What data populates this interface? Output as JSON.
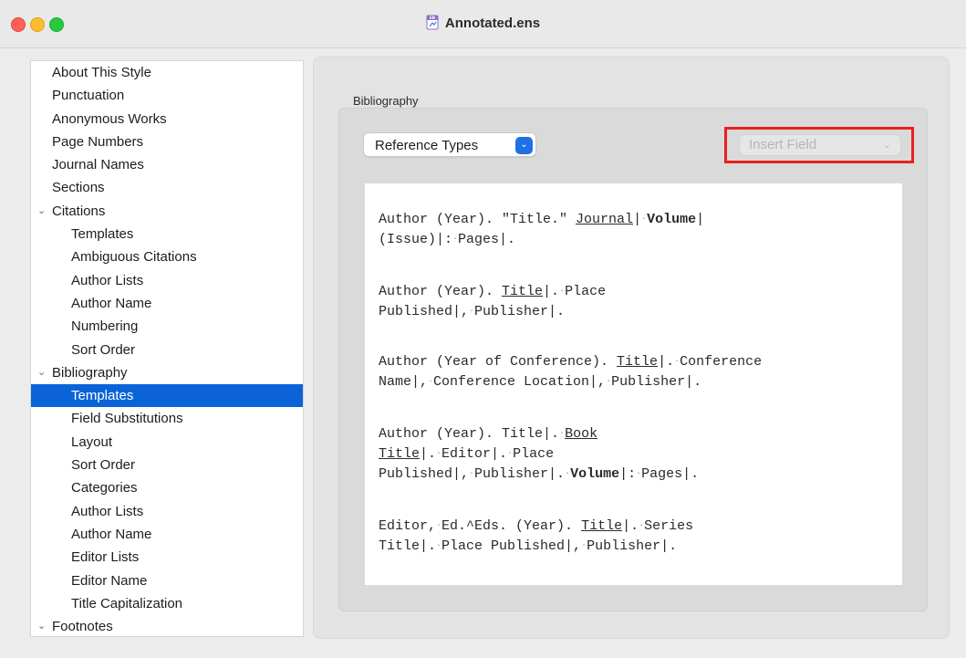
{
  "window": {
    "title": "Annotated.ens"
  },
  "sidebar": {
    "items": [
      {
        "label": "About This Style"
      },
      {
        "label": "Punctuation"
      },
      {
        "label": "Anonymous Works"
      },
      {
        "label": "Page Numbers"
      },
      {
        "label": "Journal Names"
      },
      {
        "label": "Sections"
      },
      {
        "label": "Citations"
      },
      {
        "label": "Templates"
      },
      {
        "label": "Ambiguous Citations"
      },
      {
        "label": "Author Lists"
      },
      {
        "label": "Author Name"
      },
      {
        "label": "Numbering"
      },
      {
        "label": "Sort Order"
      },
      {
        "label": "Bibliography"
      },
      {
        "label": "Templates"
      },
      {
        "label": "Field Substitutions"
      },
      {
        "label": "Layout"
      },
      {
        "label": "Sort Order"
      },
      {
        "label": "Categories"
      },
      {
        "label": "Author Lists"
      },
      {
        "label": "Author Name"
      },
      {
        "label": "Editor Lists"
      },
      {
        "label": "Editor Name"
      },
      {
        "label": "Title Capitalization"
      },
      {
        "label": "Footnotes"
      }
    ],
    "selected_index": 14
  },
  "main": {
    "group_label": "Bibliography",
    "reference_types_label": "Reference Types",
    "insert_field_label": "Insert Field",
    "templates": [
      {
        "line1": [
          "Author (Year). \"Title.\" ",
          "Journal",
          "|",
          "·",
          "Volume",
          "|"
        ],
        "line2": [
          "(Issue)|:",
          "·",
          "Pages|."
        ]
      },
      {
        "line1": [
          "Author (Year). ",
          "Title",
          "|.",
          "·",
          "Place"
        ],
        "line2": [
          "Published|,",
          "·",
          "Publisher|."
        ]
      },
      {
        "line1": [
          "Author (Year of Conference). ",
          "Title",
          "|.",
          "·",
          "Conference"
        ],
        "line2": [
          "Name|,",
          "·",
          "Conference Location|,",
          "·",
          "Publisher|."
        ]
      },
      {
        "line1": [
          "Author (Year). Title|.",
          "·",
          "Book"
        ],
        "line2": [
          "Title",
          "|.",
          "·",
          "Editor|.",
          "·",
          "Place"
        ],
        "line3": [
          "Published|,",
          "·",
          "Publisher|.",
          "·",
          "Volume",
          "|:",
          "·",
          "Pages|."
        ]
      },
      {
        "line1": [
          "Editor,",
          "·",
          "Ed.^Eds. (Year). ",
          "Title",
          "|.",
          "·",
          "Series"
        ],
        "line2": [
          "Title|.",
          "·",
          "Place Published|,",
          "·",
          "Publisher|."
        ]
      }
    ]
  },
  "colors": {
    "selection": "#0b63d8",
    "highlight_box": "#e8221b",
    "popup_button": "#1f6fe5"
  }
}
